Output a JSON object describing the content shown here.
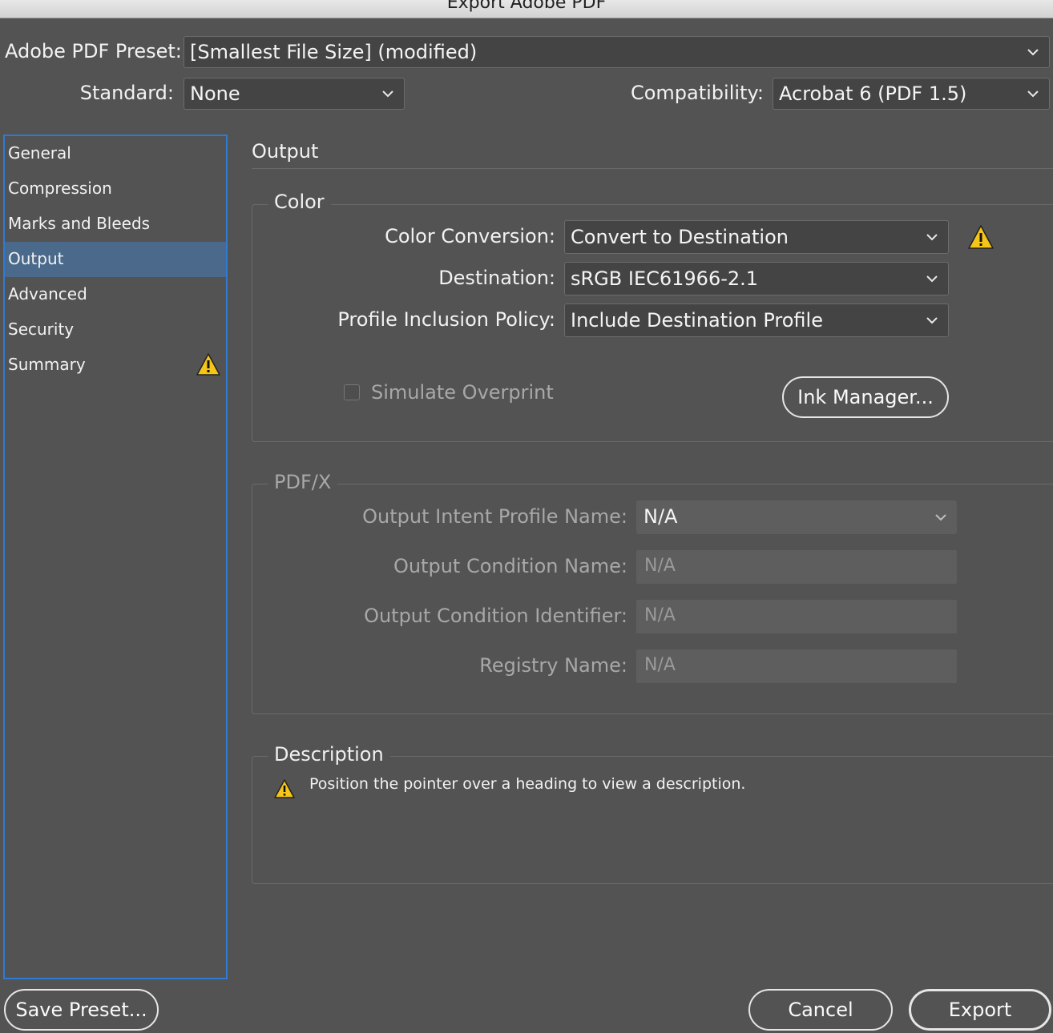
{
  "window": {
    "title": "Export Adobe PDF"
  },
  "preset": {
    "label": "Adobe PDF Preset:",
    "value": "[Smallest File Size] (modified)"
  },
  "standard": {
    "label": "Standard:",
    "value": "None"
  },
  "compatibility": {
    "label": "Compatibility:",
    "value": "Acrobat 6 (PDF 1.5)"
  },
  "sidebar": {
    "items": [
      {
        "label": "General"
      },
      {
        "label": "Compression"
      },
      {
        "label": "Marks and Bleeds"
      },
      {
        "label": "Output"
      },
      {
        "label": "Advanced"
      },
      {
        "label": "Security"
      },
      {
        "label": "Summary"
      }
    ],
    "selected": "Output"
  },
  "main": {
    "title": "Output",
    "color": {
      "legend": "Color",
      "conversion": {
        "label": "Color Conversion:",
        "value": "Convert to Destination"
      },
      "destination": {
        "label": "Destination:",
        "value": "sRGB IEC61966-2.1"
      },
      "profile_policy": {
        "label": "Profile Inclusion Policy:",
        "value": "Include Destination Profile"
      },
      "simulate_overprint": {
        "label": "Simulate Overprint",
        "checked": false
      },
      "ink_manager": "Ink Manager..."
    },
    "pdfx": {
      "legend": "PDF/X",
      "intent_profile": {
        "label": "Output Intent Profile Name:",
        "value": "N/A"
      },
      "condition_name": {
        "label": "Output Condition Name:",
        "value": "N/A"
      },
      "condition_identifier": {
        "label": "Output Condition Identifier:",
        "value": "N/A"
      },
      "registry_name": {
        "label": "Registry Name:",
        "value": "N/A"
      }
    },
    "description": {
      "legend": "Description",
      "text": "Position the pointer over a heading to view a description."
    }
  },
  "footer": {
    "save_preset": "Save Preset...",
    "cancel": "Cancel",
    "export": "Export"
  },
  "colors": {
    "background": "#535353",
    "selection": "#4b6a8b",
    "focus_border": "#2f7bd3",
    "warning": "#f5c518"
  },
  "icons": [
    "chevron-down-icon",
    "warning-icon"
  ]
}
